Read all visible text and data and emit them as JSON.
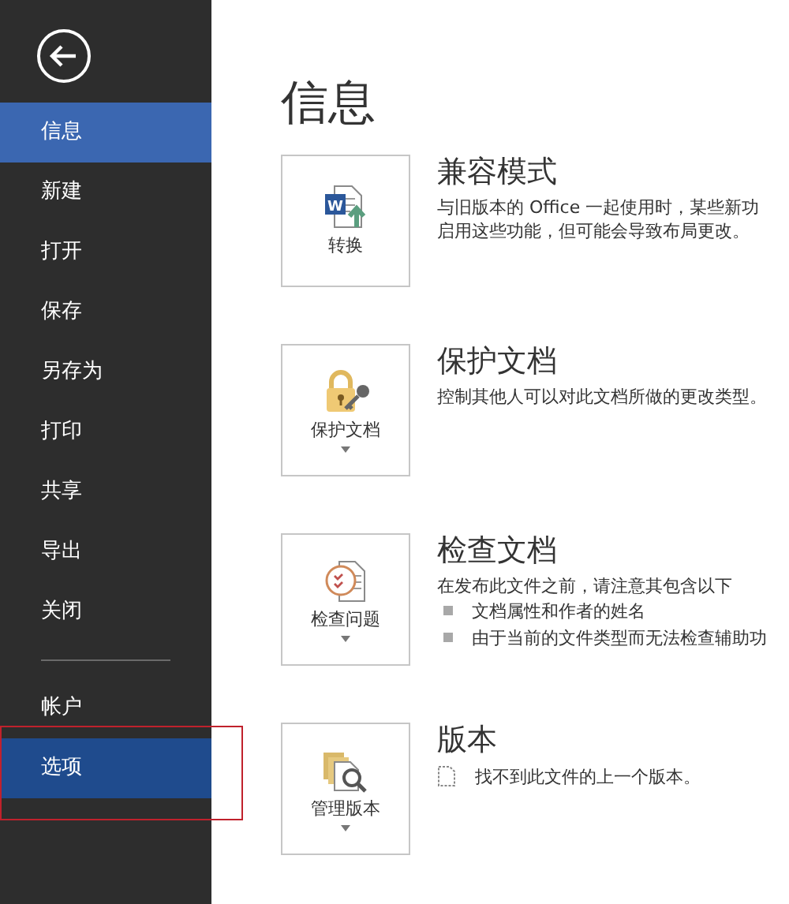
{
  "sidebar": {
    "items": [
      {
        "label": "信息",
        "selected": true,
        "hovered": false,
        "divider_before": false
      },
      {
        "label": "新建",
        "selected": false,
        "hovered": false,
        "divider_before": false
      },
      {
        "label": "打开",
        "selected": false,
        "hovered": false,
        "divider_before": false
      },
      {
        "label": "保存",
        "selected": false,
        "hovered": false,
        "divider_before": false
      },
      {
        "label": "另存为",
        "selected": false,
        "hovered": false,
        "divider_before": false
      },
      {
        "label": "打印",
        "selected": false,
        "hovered": false,
        "divider_before": false
      },
      {
        "label": "共享",
        "selected": false,
        "hovered": false,
        "divider_before": false
      },
      {
        "label": "导出",
        "selected": false,
        "hovered": false,
        "divider_before": false
      },
      {
        "label": "关闭",
        "selected": false,
        "hovered": false,
        "divider_before": false
      },
      {
        "label": "帐户",
        "selected": false,
        "hovered": false,
        "divider_before": true
      },
      {
        "label": "选项",
        "selected": false,
        "hovered": true,
        "divider_before": false,
        "annotated": true
      }
    ]
  },
  "page_title": "信息",
  "sections": [
    {
      "kind": "convert",
      "icon_letter": "W",
      "button": "转换",
      "has_menu": false,
      "title": "兼容模式",
      "lines": [
        "与旧版本的 Office 一起使用时，某些新功",
        "启用这些功能，但可能会导致布局更改。"
      ]
    },
    {
      "kind": "protect",
      "button": "保护文档",
      "has_menu": true,
      "title": "保护文档",
      "lines": [
        "控制其他人可以对此文档所做的更改类型。"
      ]
    },
    {
      "kind": "inspect",
      "button": "检查问题",
      "has_menu": true,
      "title": "检查文档",
      "lines": [
        "在发布此文件之前，请注意其包含以下"
      ],
      "bullets": [
        "文档属性和作者的姓名",
        "由于当前的文件类型而无法检查辅助功"
      ]
    },
    {
      "kind": "versions",
      "button": "管理版本",
      "has_menu": true,
      "title": "版本",
      "note": "找不到此文件的上一个版本。"
    }
  ]
}
